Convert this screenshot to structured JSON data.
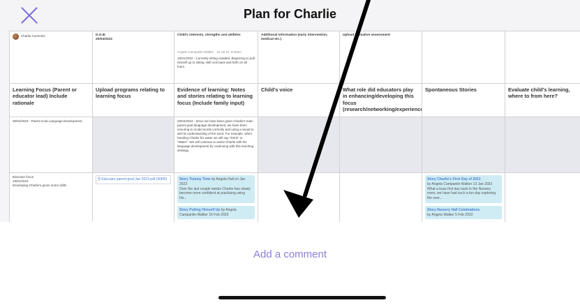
{
  "header": {
    "title": "Plan for Charlie"
  },
  "row1": {
    "child_name": "Charlie Cummins",
    "dob_label": "D.O.B:",
    "dob_value": "20/04/2022",
    "interests_header": "Child's interests, strengths and abilities",
    "interests_meta": "Angela Campanile-Walker · 16 Jul 10, 9:00am",
    "interests_text": "16/01/2022 - Currently sitting unaided. Beginning to pull himself up to sitting. Will rock back and forth on all fours.",
    "additional_header": "Additional information (early intervention, medical etc.)",
    "upload_header": "Upload formative assessment"
  },
  "header_row": {
    "c1": "Learning Focus (Parent or educator lead) Include rationale",
    "c2": "Upload programs relating to learning focus",
    "c3": "Evidence of learning: Notes and stories relating to learning focus (Include family input)",
    "c4": "Child's voice",
    "c5": "What role did educators play in enhancing/developing this focus (research/networking/experiences)?",
    "c6": "Spontaneous Stories",
    "c7": "Evaluate child's learning, where to from here?"
  },
  "row2": {
    "focus": "05/04/2023 - Parent Goal Language Development",
    "evidence": "20/04/2023 - Since we have been given Charlie's main parent goal language development, we have been ensuring to model words correctly and using a visual to aid his understanding of the word. For example, when handing Charlie his water we will say \"Drink\" or \"Water\". We will continue to assist Charlie with his language development by continuing with this teaching strategy."
  },
  "row3": {
    "focus_line1": "Educator focus",
    "focus_line2": "16/01/2023",
    "focus_line3": "Developing Charlie's gross motor skills",
    "upload_file": "Educator parent goal Jan 2023.pdf",
    "upload_size": "(90KB)",
    "evidence_card1_title": "Story Tummy Time",
    "evidence_card1_by": "by Angela Hall on Jan 2023",
    "evidence_card1_text": "Over the last couple weeks Charlie has slowly become more confident at practising using his...",
    "evidence_card2_title": "Story Pulling Himself Up",
    "evidence_card2_by": "by Angela Campanile-Walker 16 Feb 2023",
    "stories_card1_title": "Story Charlie's First Day of 2023",
    "stories_card1_by": "by Angela Campanile-Walker 13 Jan 2023",
    "stories_card1_text": "What a busy first day back in the Nursery room, we have had such a fun day exploring the new...",
    "stories_card2_title": "Story Nursery Hall Celebrations",
    "stories_card2_by": "by Angela Walker 5 Feb 2023"
  },
  "footer": {
    "comment_placeholder": "Add a comment"
  },
  "colors": {
    "accent": "#7b6fd6",
    "story_card": "#cfecf5",
    "link": "#4a7fd1"
  }
}
